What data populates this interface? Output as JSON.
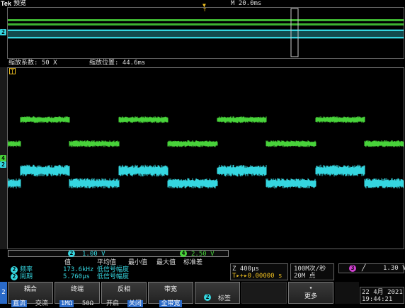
{
  "top": {
    "brand": "Tek",
    "mode": "预览",
    "timebase": "M 20.0ms",
    "trigger_pos_marker": "T"
  },
  "zoom": {
    "factor_label": "缩放系数: 50 X",
    "position_label": "缩放位置: 44.6ms",
    "trigger_marker": "T"
  },
  "channel_markers": {
    "overview_ch2": "2",
    "main_ch4": "4",
    "main_ch2": "2"
  },
  "colors": {
    "ch2": "#35d6e0",
    "ch4": "#48d23a",
    "trigger": "#f0c020",
    "selected": "#2a6ac8"
  },
  "scale_readouts": {
    "ch2_badge": "2",
    "ch2_scale": "1.00 V",
    "ch4_badge": "4",
    "ch4_scale": "2.50 V"
  },
  "measurements": {
    "headers": [
      "值",
      "平均值",
      "最小值",
      "最大值",
      "标准差"
    ],
    "rows": [
      {
        "badge": "2",
        "name": "频率",
        "value": "173.6kHz",
        "note": "低信号幅度"
      },
      {
        "badge": "2",
        "name": "周期",
        "value": "5.760µs",
        "note": "低信号幅度"
      }
    ]
  },
  "horizontal": {
    "scale": "Z 400µs",
    "position": "T▸+▸0.00000 s",
    "trigger_icon": "trigger-position-icon"
  },
  "acquisition": {
    "rate": "100M次/秒",
    "record": "20M 点"
  },
  "trigger": {
    "badge": "3",
    "slope_icon": "rising-edge-icon",
    "slope_glyph": "╱",
    "level": "1.30 V"
  },
  "bottom_menu": {
    "channel_tab": "2",
    "coupling": {
      "label": "耦合",
      "options": [
        "直流",
        "交流"
      ],
      "selected": 0
    },
    "termination": {
      "label": "终端",
      "options": [
        "1MΩ",
        "50Ω"
      ],
      "selected": 0
    },
    "invert": {
      "label": "反相",
      "options": [
        "开启",
        "关闭"
      ],
      "selected": 1
    },
    "bandwidth": {
      "label": "带宽",
      "value": "全带宽"
    },
    "label_btn": {
      "badge": "2",
      "label": "标签"
    },
    "more": {
      "label": "更多",
      "arrow": "▾"
    }
  },
  "datetime": {
    "date": "22 4月  2021",
    "time": "19:44:21"
  }
}
